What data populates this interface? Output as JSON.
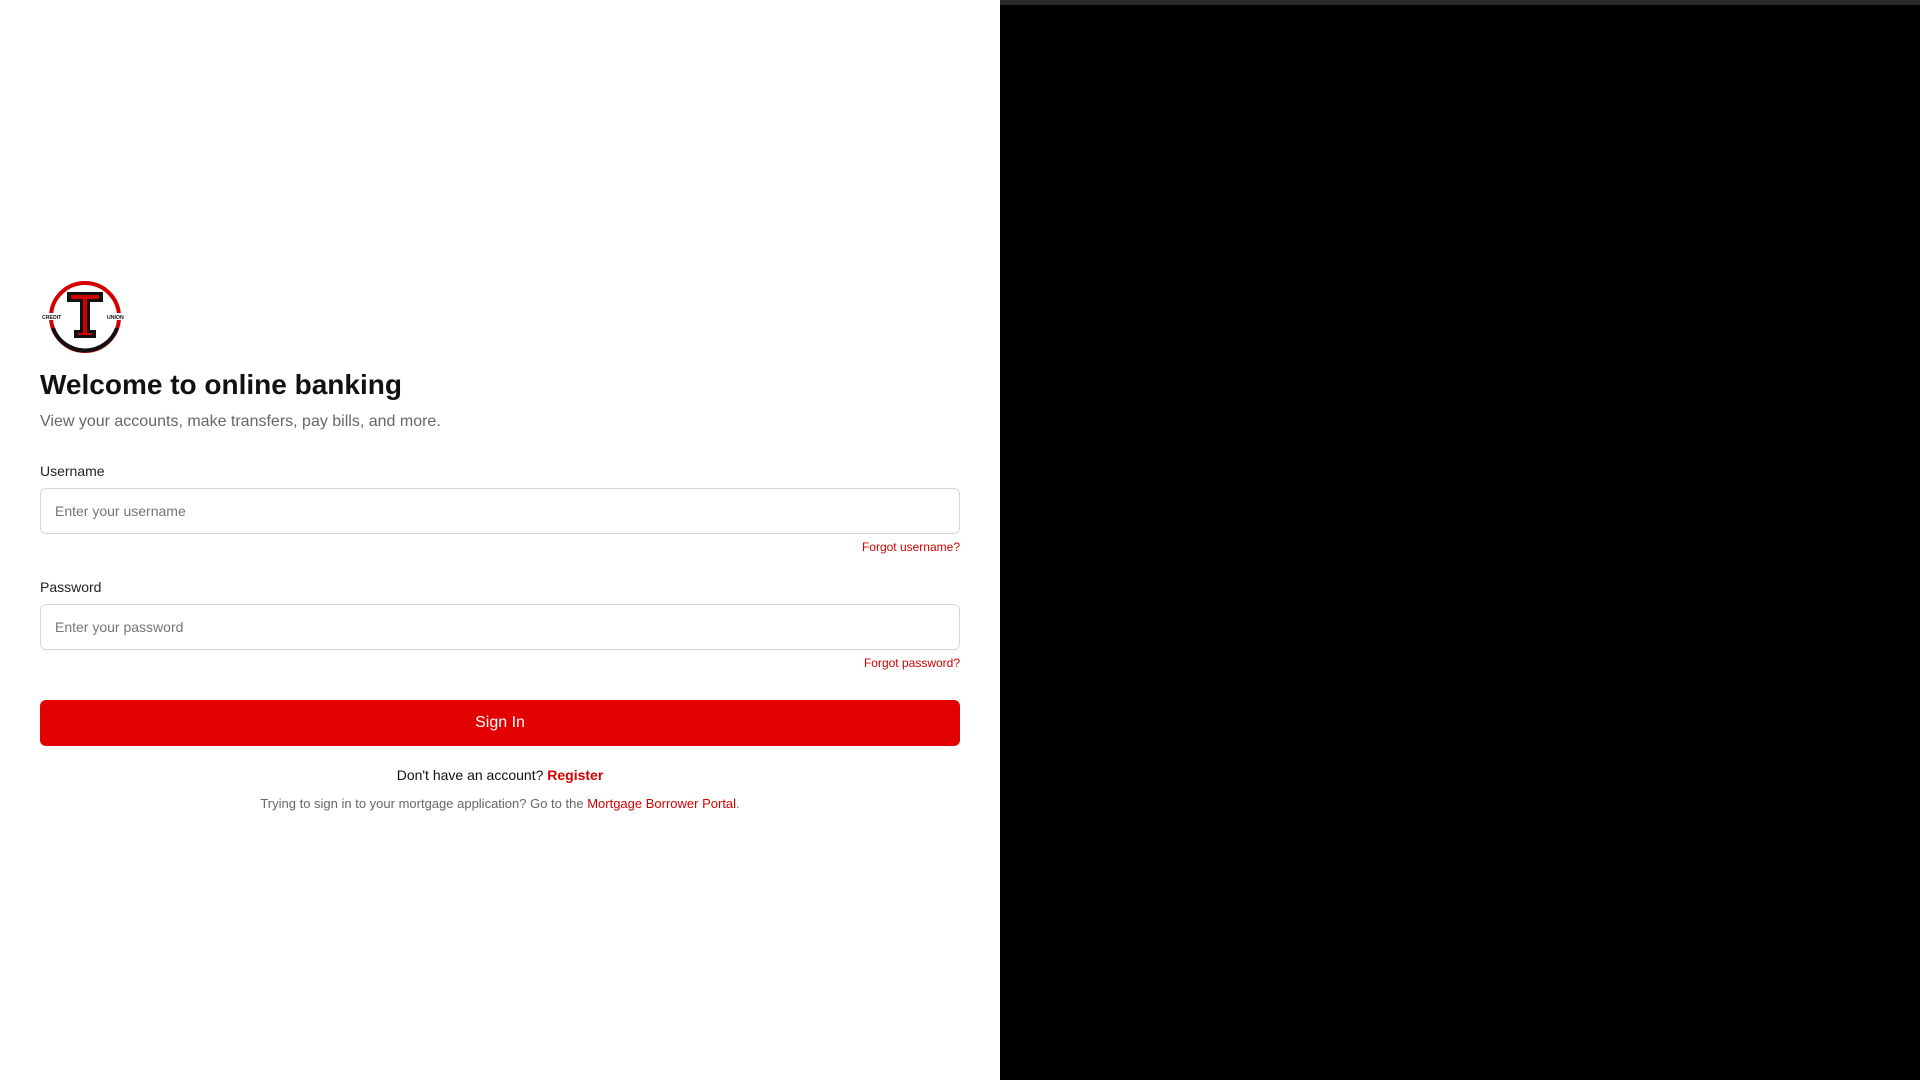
{
  "brand": {
    "logo_left_text": "CREDIT",
    "logo_right_text": "UNION",
    "accent_color": "#e30000",
    "logo_colors": [
      "#d40000",
      "#111111",
      "#ffffff"
    ]
  },
  "heading": {
    "title": "Welcome to online banking",
    "subtitle": "View your accounts, make transfers, pay bills, and more."
  },
  "form": {
    "username": {
      "label": "Username",
      "placeholder": "Enter your username",
      "value": "",
      "forgot_link": "Forgot username?"
    },
    "password": {
      "label": "Password",
      "placeholder": "Enter your password",
      "value": "",
      "forgot_link": "Forgot password?"
    },
    "submit_label": "Sign In"
  },
  "register": {
    "prompt": "Don't have an account?",
    "link": "Register"
  },
  "mortgage": {
    "prompt": "Trying to sign in to your mortgage application? Go to the",
    "link": "Mortgage Borrower Portal",
    "suffix": "."
  }
}
